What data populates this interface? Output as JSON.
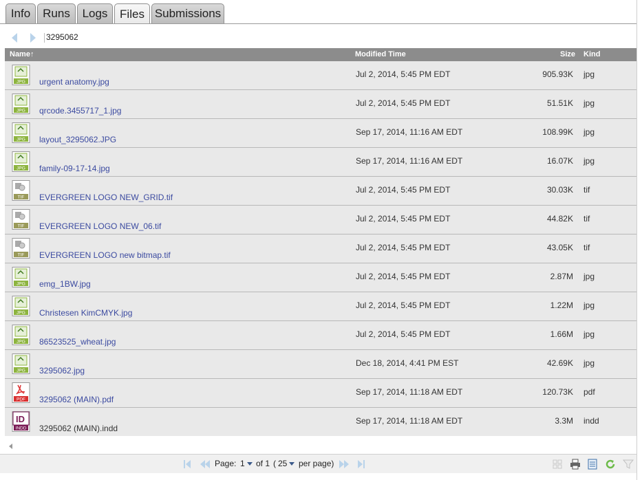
{
  "tabs": [
    {
      "label": "Info"
    },
    {
      "label": "Runs"
    },
    {
      "label": "Logs"
    },
    {
      "label": "Files",
      "active": true
    },
    {
      "label": "Submissions"
    }
  ],
  "path": "3295062",
  "columns": {
    "name": "Name↑",
    "modified": "Modified Time",
    "size": "Size",
    "kind": "Kind"
  },
  "files": [
    {
      "icon": "jpg-file-icon",
      "badge": "JPG",
      "name": "urgent anatomy.jpg",
      "modified": "Jul 2, 2014, 5:45 PM EDT",
      "size": "905.93K",
      "kind": "jpg"
    },
    {
      "icon": "jpg-file-icon",
      "badge": "JPG",
      "name": "qrcode.3455717_1.jpg",
      "modified": "Jul 2, 2014, 5:45 PM EDT",
      "size": "51.51K",
      "kind": "jpg"
    },
    {
      "icon": "jpg-file-icon",
      "badge": "JPG",
      "name": "layout_3295062.JPG",
      "modified": "Sep 17, 2014, 11:16 AM EDT",
      "size": "108.99K",
      "kind": "jpg"
    },
    {
      "icon": "jpg-file-icon",
      "badge": "JPG",
      "name": "family-09-17-14.jpg",
      "modified": "Sep 17, 2014, 11:16 AM EDT",
      "size": "16.07K",
      "kind": "jpg"
    },
    {
      "icon": "tif-file-icon",
      "badge": "TIF",
      "name": "EVERGREEN LOGO NEW_GRID.tif",
      "modified": "Jul 2, 2014, 5:45 PM EDT",
      "size": "30.03K",
      "kind": "tif"
    },
    {
      "icon": "tif-file-icon",
      "badge": "TIF",
      "name": "EVERGREEN LOGO NEW_06.tif",
      "modified": "Jul 2, 2014, 5:45 PM EDT",
      "size": "44.82K",
      "kind": "tif"
    },
    {
      "icon": "tif-file-icon",
      "badge": "TIF",
      "name": "EVERGREEN LOGO new bitmap.tif",
      "modified": "Jul 2, 2014, 5:45 PM EDT",
      "size": "43.05K",
      "kind": "tif"
    },
    {
      "icon": "jpg-file-icon",
      "badge": "JPG",
      "name": "emg_1BW.jpg",
      "modified": "Jul 2, 2014, 5:45 PM EDT",
      "size": "2.87M",
      "kind": "jpg"
    },
    {
      "icon": "jpg-file-icon",
      "badge": "JPG",
      "name": "Christesen KimCMYK.jpg",
      "modified": "Jul 2, 2014, 5:45 PM EDT",
      "size": "1.22M",
      "kind": "jpg"
    },
    {
      "icon": "jpg-file-icon",
      "badge": "JPG",
      "name": "86523525_wheat.jpg",
      "modified": "Jul 2, 2014, 5:45 PM EDT",
      "size": "1.66M",
      "kind": "jpg"
    },
    {
      "icon": "jpg-file-icon",
      "badge": "JPG",
      "name": "3295062.jpg",
      "modified": "Dec 18, 2014, 4:41 PM EST",
      "size": "42.69K",
      "kind": "jpg"
    },
    {
      "icon": "pdf-file-icon",
      "badge": "PDF",
      "name": "3295062 (MAIN).pdf",
      "modified": "Sep 17, 2014, 11:18 AM EDT",
      "size": "120.73K",
      "kind": "pdf"
    },
    {
      "icon": "indd-file-icon",
      "badge": "INDD",
      "name": "3295062 (MAIN).indd",
      "modified": "Sep 17, 2014, 11:18 AM EDT",
      "size": "3.3M",
      "kind": "indd"
    }
  ],
  "pager": {
    "page_label": "Page:",
    "page": "1",
    "of_label": "of 1",
    "open_paren": "(",
    "per_page": "25",
    "per_page_label": "per page)"
  }
}
